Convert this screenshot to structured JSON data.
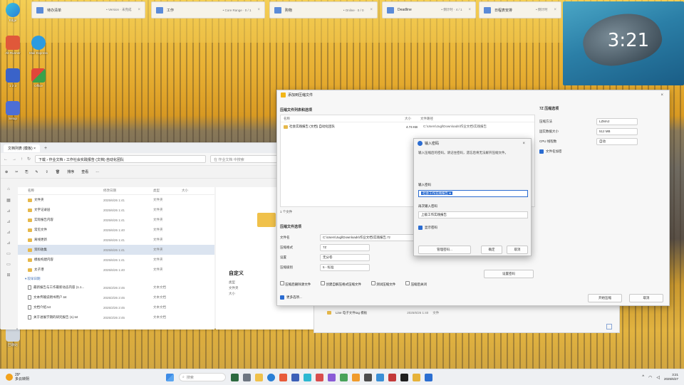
{
  "top_widgets": [
    {
      "title": "待办清单",
      "sub": "• Version · 未完成"
    },
    {
      "title": "工作",
      "sub": "• Core Range · 0 / 1"
    },
    {
      "title": "购物",
      "sub": "• Online · 0 / 0"
    },
    {
      "title": "Deadline",
      "sub": "• 倒计时 · 4 / 1"
    },
    {
      "title": "日程表安排",
      "sub": "• 倒计时"
    }
  ],
  "clock": {
    "time": "3:21"
  },
  "desktop_icons": [
    {
      "label": "Edge"
    },
    {
      "label": "Alt Runner"
    },
    {
      "label": "Mail Express"
    },
    {
      "label": "1 2 3"
    },
    {
      "label": "Office"
    },
    {
      "label": "Setup"
    },
    {
      "label": "回收站"
    }
  ],
  "explorer": {
    "tab": "文档列表 (模板) ×",
    "path": "下载 › 作业文档 › 工作社会实践报告 (文档) 自动化团队",
    "search_placeholder": "在 作业文档 中搜索",
    "toolbar": {
      "sort": "排序",
      "view": "查看",
      "more": "···"
    },
    "columns": [
      "名称",
      "修改日期",
      "类型",
      "大小"
    ],
    "folders": [
      {
        "name": "文件夹",
        "date": "2025/6/26 1:41",
        "type": "文件夹",
        "selected": false
      },
      {
        "name": "文字记录层",
        "date": "2025/6/26 1:41",
        "type": "文件夹",
        "selected": false
      },
      {
        "name": "实际报告内容",
        "date": "2025/6/26 1:41",
        "type": "文件夹",
        "selected": false
      },
      {
        "name": "常见文件",
        "date": "2025/6/26 1:40",
        "type": "文件夹",
        "selected": false
      },
      {
        "name": "离线更新",
        "date": "2025/6/26 1:41",
        "type": "文件夹",
        "selected": false
      },
      {
        "name": "资料收集",
        "date": "2025/6/26 1:41",
        "type": "文件夹",
        "selected": true
      },
      {
        "name": "模板构建内容",
        "date": "2025/6/26 1:41",
        "type": "文件夹",
        "selected": false
      },
      {
        "name": "太子港",
        "date": "2025/6/26 1:40",
        "type": "文件夹",
        "selected": false
      }
    ],
    "group_label": "▾ 较早日期",
    "files": [
      {
        "name": "最新报告与工作最新动态内容 (1.1...",
        "date": "2025/2/26 2:45",
        "type": "文本文档"
      },
      {
        "name": "文本传输说明书用户.txt",
        "date": "2025/2/26 2:45",
        "type": "文本文档"
      },
      {
        "name": "文档介绍.txt",
        "date": "2025/2/26 2:45",
        "type": "文本文档"
      },
      {
        "name": "关于进展学期的研究报告 (1).txt",
        "date": "2025/2/26 2:45",
        "type": "文本文档"
      }
    ],
    "preview_title": "自定义",
    "preview_lines": [
      "类型",
      "文件夹",
      "大小"
    ]
  },
  "dialog": {
    "title": "添加到压缩文件",
    "list_header": "压缩文件列表和选项",
    "list_columns": [
      "名称",
      "大小",
      "文件路径"
    ],
    "list_item": {
      "name": "社会实践报告 (文档) 自动化团队",
      "size": "4.74 KB",
      "path": "C:\\Users\\Jugl\\Downloads\\作业文档\\实践报告"
    },
    "list_footer": "1 个文件",
    "options_header": "压缩文件选项",
    "fields": [
      {
        "label": "文件名",
        "value": "C:\\Users\\Jugl\\Downloads\\作业文档\\实践报告.7z"
      },
      {
        "label": "压缩格式",
        "value": "7Z"
      },
      {
        "label": "设置",
        "value": "无分卷"
      },
      {
        "label": "压缩级别",
        "value": "5 - 标准"
      }
    ],
    "right_header": "7Z 压缩选项",
    "right_fields": [
      {
        "label": "压缩方法",
        "value": "LZMA2"
      },
      {
        "label": "固实数据大小",
        "value": "512 MB"
      },
      {
        "label": "CPU 线程数",
        "value": "自动"
      }
    ],
    "right_check": "文件名加密",
    "set_password_btn": "设置密码",
    "checks": [
      "压缩后删除源文件",
      "创建自解压格式压缩文件",
      "测试压缩文件",
      "压缩后关闭"
    ],
    "bottom_check": "更多选项...",
    "ok_label": "开始压缩",
    "cancel_label": "取消"
  },
  "password_dialog": {
    "title": "输入密码",
    "hint": "输入压缩后的密码。请记住密码，遗忘后将无法解开压缩文件。",
    "enter_label": "输入密码",
    "enter_value": "社会工作实践报告 ●",
    "reenter_label": "再次输入密码",
    "reenter_value": "上级工作实践报告",
    "show_label": "显示密码",
    "manage_label": "管理密码...",
    "ok_label": "确定",
    "cancel_label": "取消"
  },
  "behind_window": {
    "row": "Line 电子文件tag 模板",
    "date": "2025/6/26 1:40",
    "type": "文件"
  },
  "taskbar": {
    "weather_temp": "29°",
    "weather_text": "多云转阴",
    "search_text": "搜索",
    "time": "3:21",
    "date": "2025/6/27"
  }
}
